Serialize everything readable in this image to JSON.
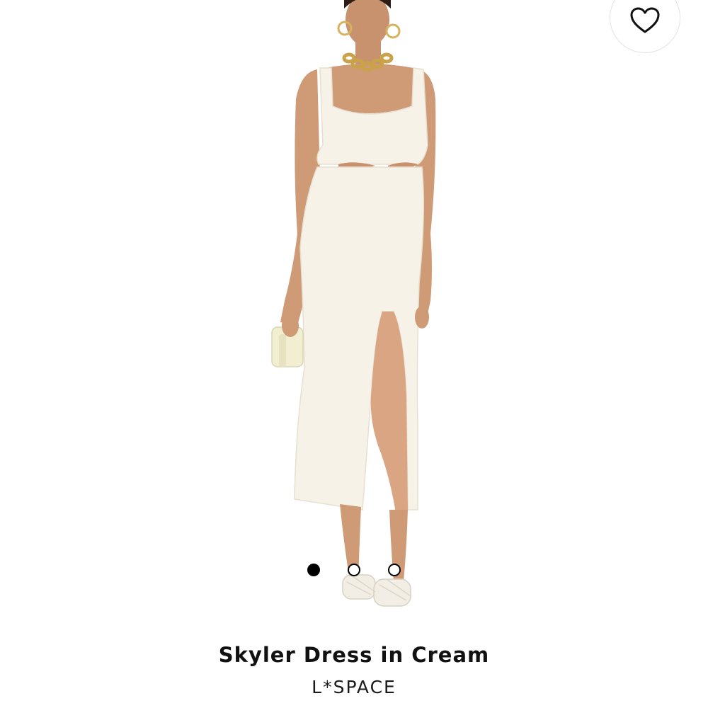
{
  "product": {
    "title": "Skyler Dress in Cream",
    "brand": "L*SPACE"
  },
  "carousel": {
    "slide_count": 3,
    "active_index": 0
  },
  "wishlist": {
    "icon": "heart-outline-icon"
  },
  "colors": {
    "background": "#ffffff",
    "dress": "#f6f2e8",
    "skin": "#d8a582",
    "accent": "#000000"
  }
}
